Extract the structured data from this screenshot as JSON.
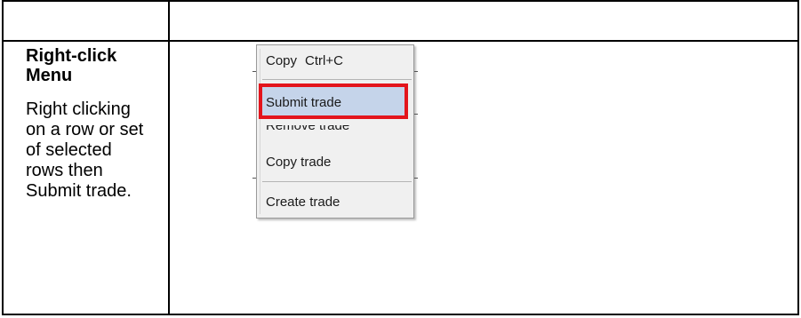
{
  "left_cell": {
    "title": "Right-click Menu",
    "description": "Right clicking on a row or set of selected rows then Submit trade."
  },
  "context_menu": {
    "items": [
      {
        "label": "Copy",
        "shortcut": "Ctrl+C"
      },
      {
        "label": "Submit trade",
        "highlighted": true
      },
      {
        "label": "Remove trade",
        "partially_obscured": true
      },
      {
        "label": "Copy trade"
      },
      {
        "label": "Create trade"
      }
    ]
  },
  "colors": {
    "highlight_fill": "#c5d4ea",
    "highlight_border": "#e3141c",
    "menu_background": "#f0f0f0"
  }
}
